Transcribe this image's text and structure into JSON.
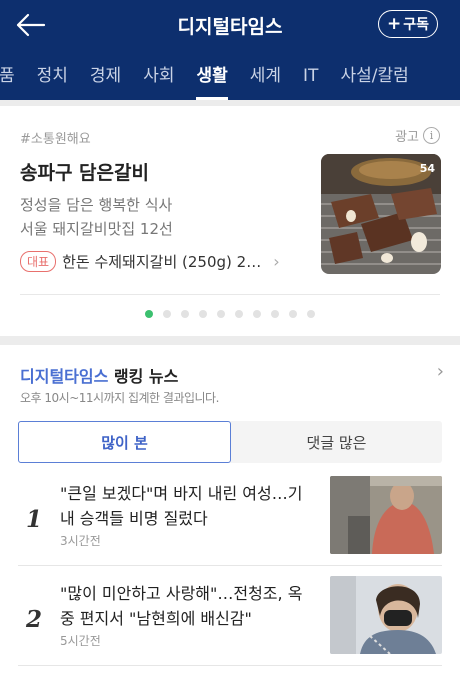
{
  "header": {
    "title": "디지털타임스",
    "subscribe_label": "구독",
    "subscribe_plus": "+"
  },
  "nav": {
    "items": [
      {
        "label": "품",
        "active": false
      },
      {
        "label": "정치",
        "active": false
      },
      {
        "label": "경제",
        "active": false
      },
      {
        "label": "사회",
        "active": false
      },
      {
        "label": "생활",
        "active": true
      },
      {
        "label": "세계",
        "active": false
      },
      {
        "label": "IT",
        "active": false
      },
      {
        "label": "사설/칼럼",
        "active": false
      }
    ]
  },
  "ad": {
    "tag": "#소통원해요",
    "ad_label": "광고",
    "info_icon": "i",
    "title": "송파구 담은갈비",
    "desc1": "정성을 담은 행복한 식사",
    "desc2": "서울 돼지갈비맛집 12선",
    "badge": "대표",
    "product": "한돈 수제돼지갈비 (250g) 2…",
    "chevron": "›",
    "image_count": "54",
    "carousel": {
      "total": 10,
      "active_index": 0
    }
  },
  "ranking": {
    "title_highlight": "디지털타임스",
    "title_rest": " 랭킹 뉴스",
    "more_icon": "›",
    "subtitle": "오후 10시~11시까지 집계한 결과입니다.",
    "tabs": [
      {
        "label": "많이 본",
        "active": true
      },
      {
        "label": "댓글 많은",
        "active": false
      }
    ],
    "items": [
      {
        "rank": "1",
        "line1": "\"큰일 보겠다\"며 바지 내린 여성…기",
        "line2": "내 승객들 비명 질렀다",
        "time": "3시간전"
      },
      {
        "rank": "2",
        "line1": "\"많이 미안하고 사랑해\"…전청조, 옥",
        "line2": "중 편지서 \"남현희에 배신감\"",
        "time": "5시간전"
      }
    ]
  },
  "colors": {
    "header_bg": "#0d2f6e",
    "accent_blue": "#4a6fd2",
    "carousel_active": "#3cc06f",
    "badge_red": "#e8706d"
  }
}
